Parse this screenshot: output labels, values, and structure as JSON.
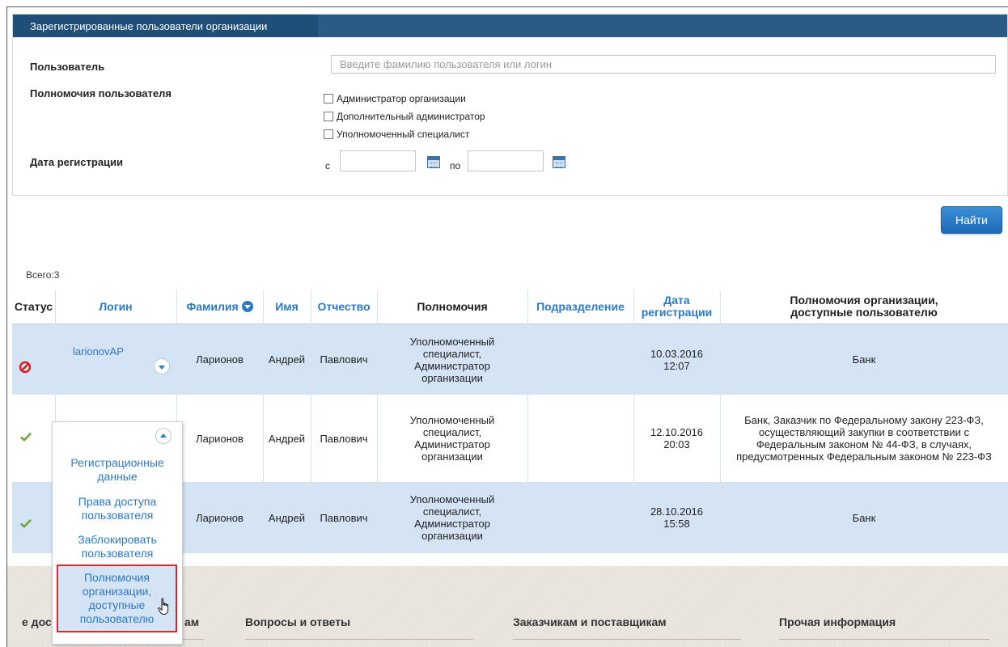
{
  "filter": {
    "title": "Зарегистрированные пользователи организации",
    "user_label": "Пользователь",
    "user_placeholder": "Введите фамилию пользователя или логин",
    "permissions_label": "Полномочия пользователя",
    "permissions": [
      "Администратор организации",
      "Дополнительный администратор",
      "Уполномоченный специалист"
    ],
    "date_label": "Дата регистрации",
    "date_from_prefix": "с",
    "date_to_prefix": "по",
    "find_button": "Найти"
  },
  "total": "Всего:3",
  "table": {
    "headers": {
      "status": "Статус",
      "login": "Логин",
      "lastname": "Фамилия",
      "firstname": "Имя",
      "patronymic": "Отчество",
      "permissions": "Полномочия",
      "department": "Подразделение",
      "reg_date": "Дата регистрации",
      "org_permissions": "Полномочия организации, доступные пользователю"
    },
    "rows": [
      {
        "status": "blocked",
        "login": "larionovAP",
        "lastname": "Ларионов",
        "firstname": "Андрей",
        "patronymic": "Павлович",
        "permissions": "Уполномоченный специалист, Администратор организации",
        "department": "",
        "reg_date": "10.03.2016 12:07",
        "org_permissions": "Банк"
      },
      {
        "status": "active",
        "login": "",
        "lastname": "Ларионов",
        "firstname": "Андрей",
        "patronymic": "Павлович",
        "permissions": "Уполномоченный специалист, Администратор организации",
        "department": "",
        "reg_date": "12.10.2016 20:03",
        "org_permissions": "Банк, Заказчик по Федеральному закону 223-ФЗ, осуществляющий закупки в соответствии с Федеральным законом № 44-ФЗ, в случаях, предусмотренных Федеральным законом № 223-ФЗ"
      },
      {
        "status": "active",
        "login": "",
        "lastname": "Ларионов",
        "firstname": "Андрей",
        "patronymic": "Павлович",
        "permissions": "Уполномоченный специалист, Администратор организации",
        "department": "",
        "reg_date": "28.10.2016 15:58",
        "org_permissions": "Банк"
      }
    ]
  },
  "dropdown_menu": {
    "items": [
      "Регистрационные данные",
      "Права доступа пользователя",
      "Заблокировать пользователя",
      "Полномочия организации, доступные пользователю"
    ]
  },
  "footer": {
    "links": [
      "е дост",
      "ам",
      "Вопросы и ответы",
      "Заказчикам и поставщикам",
      "Прочая информация"
    ]
  },
  "colors": {
    "header_bg": "#1f4e79",
    "link": "#2a7ac9",
    "row_highlight": "#d4e4f5",
    "button": "#2e7dc8",
    "blocked": "#d81e1e",
    "active": "#7bb33a"
  }
}
